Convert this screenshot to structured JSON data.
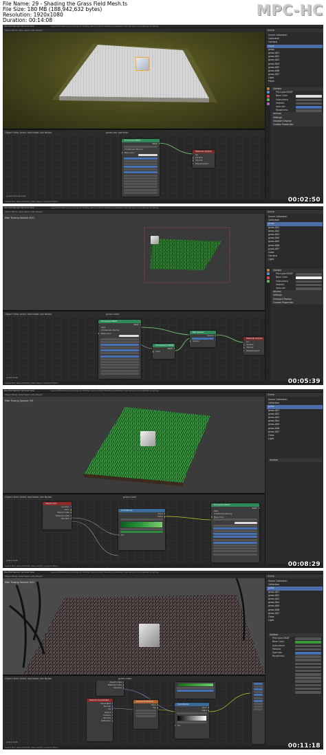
{
  "header": {
    "file_name": "File Name: 29 - Shading the Grass Field Mesh.ts",
    "file_size": "File Size: 180 MB (188,942,632 bytes)",
    "resolution": "Resolution: 1920x1080",
    "duration": "Duration: 00:14:08",
    "logo": "MPC-HC"
  },
  "frames": [
    {
      "timestamp": "00:02:50",
      "viewport_label": "",
      "node_editor_label": "grass.hair.particles",
      "node_tree_label": "grass hair particles",
      "active_tab": "Layout"
    },
    {
      "timestamp": "00:05:39",
      "viewport_label": "Path Tracing Sample 6/21",
      "node_editor_label": "grass.mesh",
      "node_tree_label": "grass mesh",
      "active_tab": "Layout"
    },
    {
      "timestamp": "00:08:29",
      "viewport_label": "Path Tracing Sample 3/9",
      "node_editor_label": "grass.mesh",
      "node_tree_label": "grass mesh",
      "active_tab": "Shading"
    },
    {
      "timestamp": "00:11:18",
      "viewport_label": "Path Tracing Sample 3/21",
      "node_editor_label": "grass.mesh",
      "node_tree_label": "grass mesh",
      "active_tab": "Shading"
    }
  ],
  "ui": {
    "menu": "File  Edit  Render  Window  Help",
    "workspace_tabs": "Layout  Modeling  Sculpting  UV Editing  Texture Paint  Shading  Animation  Rendering  Compositing  Scripting",
    "viewport_header": "Object Mode   View   Select   Add   Object",
    "node_header": "Object   View   Select   Add   Node   Use Nodes",
    "status": "Select     Box Select     Rotate View     Object Context Menu",
    "scene_label": "Scene",
    "outliner_items": [
      "Scene Collection",
      "Collection",
      "Camera",
      "Cube",
      "grass",
      "grass.001",
      "grass.002",
      "grass.003",
      "grass.004",
      "grass.005",
      "grass.006",
      "grass.007",
      "Light",
      "Plane"
    ],
    "properties": [
      "Surface",
      "Principled BSDF",
      "Base Color",
      "Subsurface",
      "Metallic",
      "Specular",
      "Roughness",
      "Volume",
      "Settings",
      "Viewport Display",
      "Custom Properties"
    ]
  },
  "nodes": {
    "principled": "Principled BSDF",
    "material_output": "Material Output",
    "mix_shader": "Mix Shader",
    "transparent": "Transparent BSDF",
    "color_ramp": "ColorRamp",
    "object_info": "Object Info",
    "texture_coord": "Texture Coordinate",
    "mix_rgb": "Mix",
    "gradient": "Gradient Texture",
    "bsdf": "BSDF",
    "surface": "Surface",
    "volume": "Volume",
    "displacement": "Displacement",
    "base_color": "Base Color",
    "roughness": "Roughness",
    "alpha": "Alpha",
    "color": "Color",
    "fac": "Fac",
    "random": "Random",
    "location": "Location",
    "generated": "Generated",
    "shader": "Shader",
    "ggx": "GGX",
    "christensen": "Christensen-Burley",
    "all": "All"
  },
  "colors": {
    "node_shader": "#2f8a5a",
    "node_output": "#7a2a2a",
    "node_input": "#8a2a2a",
    "node_converter": "#3a6a9a",
    "node_texture": "#b0622a",
    "grass_green": "#2e7d32",
    "socket_yellow": "#c7c729"
  }
}
